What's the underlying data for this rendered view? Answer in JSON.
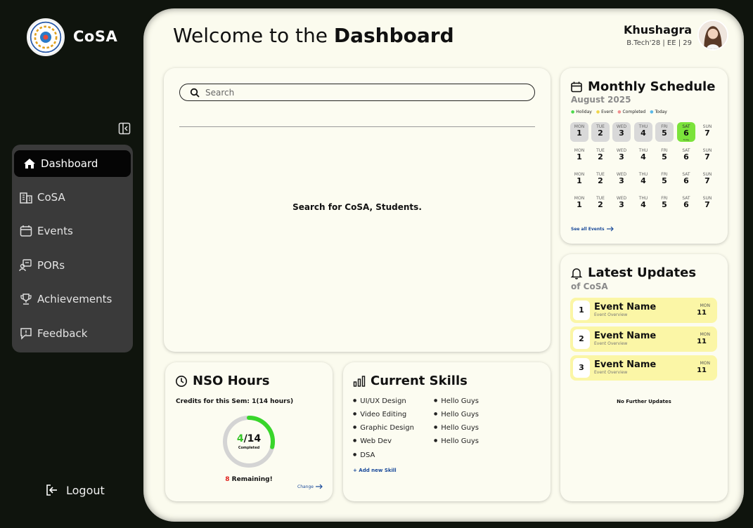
{
  "sidebar": {
    "brand": "CoSA",
    "logo_icon": "cosa-logo",
    "items": [
      {
        "label": "Dashboard",
        "icon": "home-icon",
        "active": true
      },
      {
        "label": "CoSA",
        "icon": "building-icon"
      },
      {
        "label": "Events",
        "icon": "calendar-icon"
      },
      {
        "label": "PORs",
        "icon": "por-icon"
      },
      {
        "label": "Achievements",
        "icon": "trophy-icon"
      },
      {
        "label": "Feedback",
        "icon": "feedback-icon"
      }
    ],
    "logout_label": "Logout"
  },
  "header": {
    "welcome_prefix": "Welcome to the ",
    "welcome_bold": "Dashboard",
    "user_name": "Khushagra",
    "user_meta": "B.Tech'28 | EE | 29"
  },
  "search": {
    "placeholder": "Search",
    "hint": "Search for CoSA, Students."
  },
  "schedule": {
    "title": "Monthly Schedule",
    "month": "August 2025",
    "legend": [
      "Holiday",
      "Event",
      "Completed",
      "Today"
    ],
    "days": [
      "MON",
      "TUE",
      "WED",
      "THU",
      "FRI",
      "SAT",
      "SUN"
    ],
    "week1": [
      "1",
      "2",
      "3",
      "4",
      "5",
      "6",
      "7"
    ],
    "week2": [
      "1",
      "2",
      "3",
      "4",
      "5",
      "6",
      "7"
    ],
    "week3": [
      "1",
      "2",
      "3",
      "4",
      "5",
      "6",
      "7"
    ],
    "week4": [
      "1",
      "2",
      "3",
      "4",
      "5",
      "6",
      "7"
    ],
    "today_tag": "Today",
    "see_all": "See all Events"
  },
  "updates": {
    "title": "Latest Updates",
    "subtitle": "of CoSA",
    "items": [
      {
        "num": "1",
        "name": "Event Name",
        "desc": "Event Overview",
        "day": "MON",
        "date": "11"
      },
      {
        "num": "2",
        "name": "Event Name",
        "desc": "Event Overview",
        "day": "MON",
        "date": "11"
      },
      {
        "num": "3",
        "name": "Event Name",
        "desc": "Event Overview",
        "day": "MON",
        "date": "11"
      }
    ],
    "no_more": "No Further Updates"
  },
  "nso": {
    "title": "NSO Hours",
    "credits": "Credits for this Sem: 1(14 hours)",
    "completed": "4",
    "total": "/14",
    "completed_label": "Completed",
    "progress": 0.2857,
    "remaining_num": "8",
    "remaining_label": " Remaining!",
    "change": "Change"
  },
  "skills": {
    "title": "Current Skills",
    "left": [
      "UI/UX Design",
      "Video Editing",
      "Graphic Design",
      "Web Dev",
      "DSA"
    ],
    "right": [
      "Hello Guys",
      "Hello Guys",
      "Hello Guys",
      "Hello Guys"
    ],
    "add": "+ Add new Skill"
  },
  "colors": {
    "accent_green": "#7be33b",
    "panel_bg": "#fbfbee",
    "app_bg": "#0f140d",
    "update_bg": "#fbf6a6",
    "link_blue": "#1a4a9a"
  }
}
